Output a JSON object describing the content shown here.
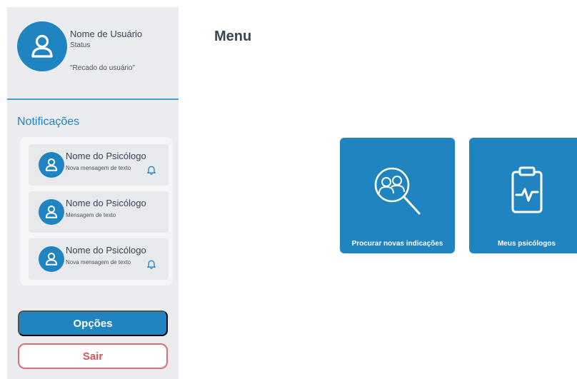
{
  "profile": {
    "user_name": "Nome de Usuário",
    "status": "Status",
    "note": "\"Recado do usuário\"",
    "avatar_icon": "user-icon"
  },
  "notifications": {
    "title": "Notificações",
    "items": [
      {
        "name": "Nome do Psicólogo",
        "message": "Nova mensagem de texto",
        "bell": true
      },
      {
        "name": "Nome do Psicólogo",
        "message": "Mensagem de texto",
        "bell": false
      },
      {
        "name": "Nome do Psicólogo",
        "message": "Nova mensagem de texto",
        "bell": true
      }
    ]
  },
  "buttons": {
    "options_label": "Opções",
    "exit_label": "Sair"
  },
  "main": {
    "title": "Menu",
    "tiles": [
      {
        "label": "Procurar novas indicações",
        "icon": "search-people-icon"
      },
      {
        "label": "Meus psicólogos",
        "icon": "clipboard-pulse-icon"
      }
    ]
  },
  "colors": {
    "primary": "#1f84bf",
    "sidebar_bg": "#ebecf0",
    "danger": "#e04f58",
    "text": "#3a4656"
  }
}
